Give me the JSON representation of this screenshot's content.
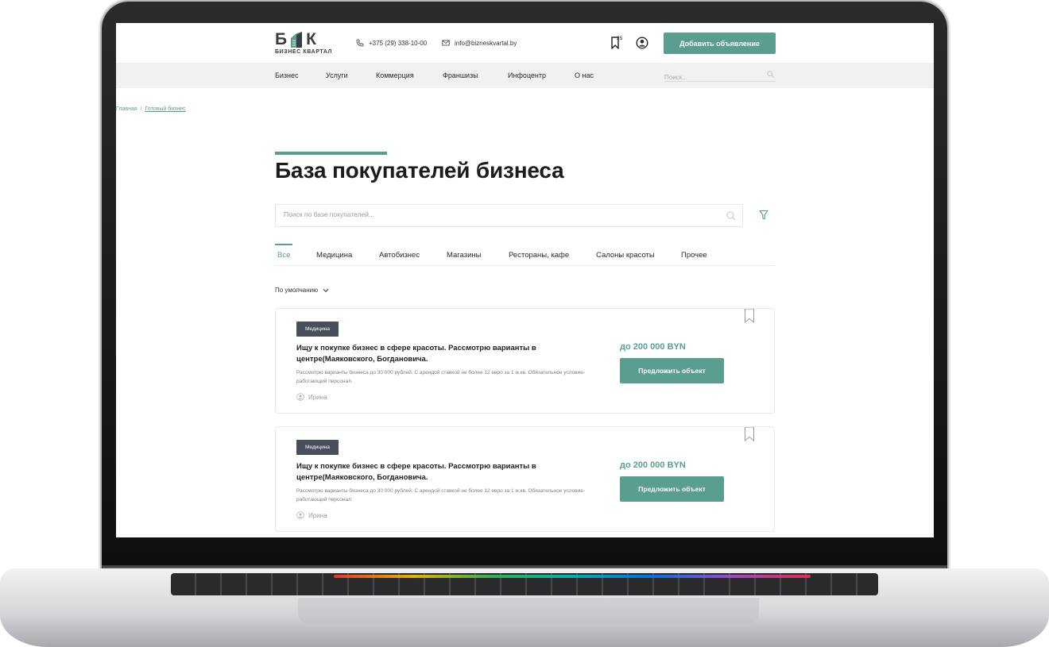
{
  "header": {
    "logo_letter_1": "Б",
    "logo_letter_2": "К",
    "logo_sub": "БИЗНЕС КВАРТАЛ",
    "phone": "+375 (29) 338-10-00",
    "email": "info@bizneskvartal.by",
    "bookmarks_count": "25",
    "add_button": "Добавить объявление"
  },
  "nav": {
    "items": [
      "Бизнес",
      "Услуги",
      "Коммерция",
      "Франшизы",
      "Инфоцентр",
      "О нас"
    ],
    "search_placeholder": "Поиск..."
  },
  "breadcrumb": {
    "home": "Главная",
    "separator": "/",
    "current": "Готовый бизнес"
  },
  "page": {
    "title": "База покупателей бизнеса",
    "search_placeholder": "Поиск по базе покупателей..."
  },
  "tabs": [
    "Все",
    "Медицина",
    "Автобизнес",
    "Магазины",
    "Рестораны, кафе",
    "Салоны красоты",
    "Прочее"
  ],
  "sort": {
    "label": "По умолчанию"
  },
  "cards": [
    {
      "badge": "Медицина",
      "title": "Ищу к покупке бизнес в сфере красоты. Рассмотрю варианты в центре(Маяковского, Богдановича.",
      "description": "Рассмотрю варианты бизнеса до 30 000 рублей. С арендой ставкой не более 12 евро за 1 м.кв. Обязательное условие- работающий персонал.",
      "author": "Ирина",
      "price": "до 200 000 BYN",
      "button": "Предложить объект"
    },
    {
      "badge": "Медицина",
      "title": "Ищу к покупке бизнес в сфере красоты. Рассмотрю варианты в центре(Маяковского, Богдановича.",
      "description": "Рассмотрю варианты бизнеса до 30 000 рублей. С арендой ставкой не более 12 евро за 1 м.кв. Обязательное условие- работающий персонал.",
      "author": "Ирина",
      "price": "до 200 000 BYN",
      "button": "Предложить объект"
    }
  ],
  "colors": {
    "accent": "#5a9e8f",
    "badge": "#494e5a",
    "nav_bg": "#f1f1f2"
  }
}
